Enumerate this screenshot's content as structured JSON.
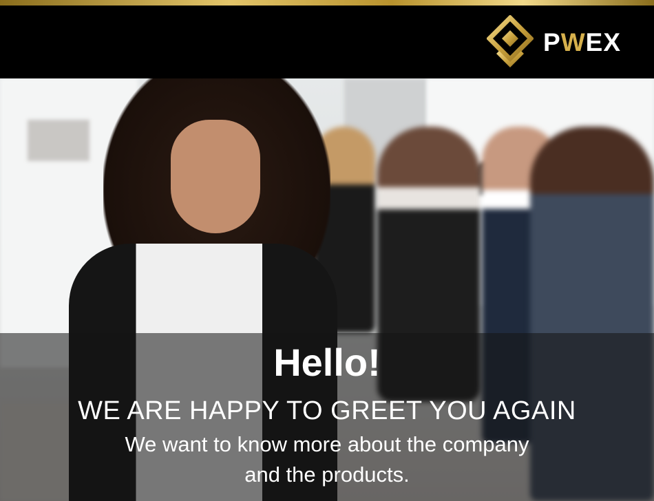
{
  "brand": {
    "name_pre": "P",
    "name_accent": "W",
    "name_post": "EX"
  },
  "colors": {
    "gold": "#d6b04c",
    "header_bg": "#000000",
    "text": "#ffffff"
  },
  "hero": {
    "greeting": "Hello!",
    "headline": "WE ARE HAPPY TO GREET YOU AGAIN",
    "subline_1": "We want to know more about the company",
    "subline_2": "and the products."
  },
  "icons": {
    "logo": "diamond-logo-icon"
  }
}
